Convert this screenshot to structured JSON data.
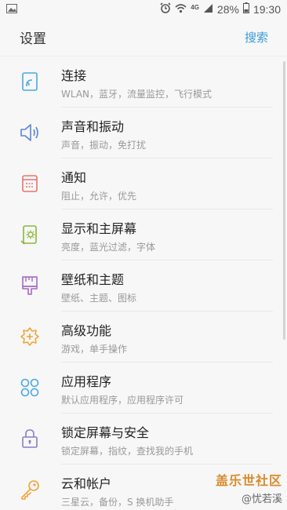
{
  "status_bar": {
    "network": "4G",
    "battery_percent": "28%",
    "time": "19:30"
  },
  "header": {
    "title": "设置",
    "search_label": "搜索"
  },
  "settings_items": [
    {
      "label": "连接",
      "sub": "WLAN，蓝牙，流量监控，飞行模式",
      "icon": "connections-icon",
      "color": "#4aa9e0"
    },
    {
      "label": "声音和振动",
      "sub": "声音，振动，免打扰",
      "icon": "speaker-icon",
      "color": "#5b84d6"
    },
    {
      "label": "通知",
      "sub": "阻止，允许，优先",
      "icon": "notification-icon",
      "color": "#e8756b"
    },
    {
      "label": "显示和主屏幕",
      "sub": "亮度，蓝光过滤，字体",
      "icon": "display-icon",
      "color": "#8bb83b"
    },
    {
      "label": "壁纸和主题",
      "sub": "壁纸、主题、图标",
      "icon": "paintbrush-icon",
      "color": "#a46ac4"
    },
    {
      "label": "高级功能",
      "sub": "游戏，单手操作",
      "icon": "advanced-gear-icon",
      "color": "#f0a43a"
    },
    {
      "label": "应用程序",
      "sub": "默认应用程序，应用程序许可",
      "icon": "apps-icon",
      "color": "#4aa9e0"
    },
    {
      "label": "锁定屏幕与安全",
      "sub": "锁定屏幕，指纹，查找我的手机",
      "icon": "lock-icon",
      "color": "#8a7fc7"
    },
    {
      "label": "云和帐户",
      "sub": "三星云，备份，S 换机助手",
      "icon": "key-icon",
      "color": "#f0a43a"
    }
  ],
  "watermark": {
    "line1": "盖乐世社区",
    "line2": "@忧若溪"
  }
}
